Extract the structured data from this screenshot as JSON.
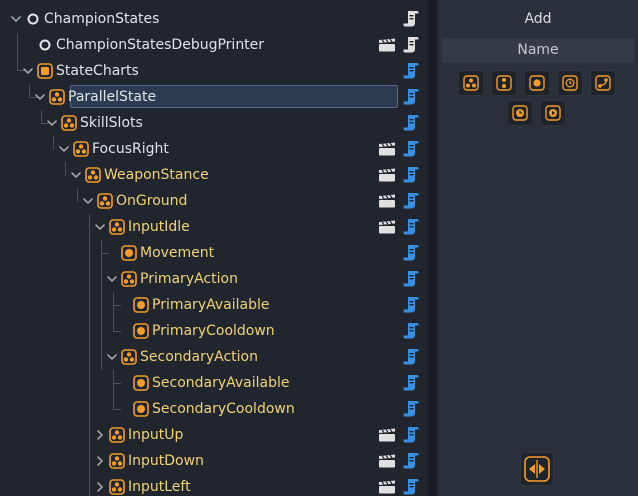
{
  "tree": {
    "rows": [
      {
        "label": "ChampionStates",
        "color": "white",
        "icon": "circle-outline-icon",
        "chevron": "down",
        "clap": false,
        "script": "gray"
      },
      {
        "label": "ChampionStatesDebugPrinter",
        "color": "white",
        "icon": "circle-outline-icon",
        "chevron": "none",
        "clap": true,
        "script": "gray"
      },
      {
        "label": "StateCharts",
        "color": "white",
        "icon": "statechart-icon",
        "chevron": "down",
        "clap": false,
        "script": "blue"
      },
      {
        "label": "ParallelState",
        "color": "white",
        "icon": "parallel-state-icon",
        "chevron": "down",
        "clap": false,
        "script": "blue",
        "selected": true
      },
      {
        "label": "SkillSlots",
        "color": "white",
        "icon": "parallel-state-icon",
        "chevron": "down",
        "clap": false,
        "script": "blue"
      },
      {
        "label": "FocusRight",
        "color": "white",
        "icon": "parallel-state-icon",
        "chevron": "down",
        "clap": true,
        "script": "blue"
      },
      {
        "label": "WeaponStance",
        "color": "gold",
        "icon": "parallel-state-icon",
        "chevron": "down",
        "clap": true,
        "script": "blue"
      },
      {
        "label": "OnGround",
        "color": "gold",
        "icon": "parallel-state-icon",
        "chevron": "down",
        "clap": true,
        "script": "blue"
      },
      {
        "label": "InputIdle",
        "color": "gold",
        "icon": "parallel-state-icon",
        "chevron": "down",
        "clap": true,
        "script": "blue"
      },
      {
        "label": "Movement",
        "color": "gold",
        "icon": "atomic-state-icon",
        "chevron": "none",
        "clap": false,
        "script": "blue"
      },
      {
        "label": "PrimaryAction",
        "color": "gold",
        "icon": "parallel-state-icon",
        "chevron": "down",
        "clap": false,
        "script": "blue"
      },
      {
        "label": "PrimaryAvailable",
        "color": "gold",
        "icon": "atomic-state-icon",
        "chevron": "none",
        "clap": false,
        "script": "blue"
      },
      {
        "label": "PrimaryCooldown",
        "color": "gold",
        "icon": "atomic-state-icon",
        "chevron": "none",
        "clap": false,
        "script": "blue"
      },
      {
        "label": "SecondaryAction",
        "color": "gold",
        "icon": "parallel-state-icon",
        "chevron": "down",
        "clap": false,
        "script": "blue"
      },
      {
        "label": "SecondaryAvailable",
        "color": "gold",
        "icon": "atomic-state-icon",
        "chevron": "none",
        "clap": false,
        "script": "blue"
      },
      {
        "label": "SecondaryCooldown",
        "color": "gold",
        "icon": "atomic-state-icon",
        "chevron": "none",
        "clap": false,
        "script": "blue"
      },
      {
        "label": "InputUp",
        "color": "gold",
        "icon": "parallel-state-icon",
        "chevron": "right",
        "clap": true,
        "script": "blue"
      },
      {
        "label": "InputDown",
        "color": "gold",
        "icon": "parallel-state-icon",
        "chevron": "right",
        "clap": true,
        "script": "blue"
      },
      {
        "label": "InputLeft",
        "color": "gold",
        "icon": "parallel-state-icon",
        "chevron": "right",
        "clap": true,
        "script": "blue"
      }
    ]
  },
  "add_panel": {
    "title": "Add",
    "column_header": "Name",
    "buttons": [
      "add-parallel-state-icon",
      "add-compound-state-icon",
      "add-atomic-state-icon",
      "add-history-state-icon",
      "add-transition-icon",
      "add-delay-icon",
      "add-event-icon"
    ],
    "toggle": "toggle-arrows-icon"
  },
  "colors": {
    "panel_bg": "#21262e",
    "selection_bg": "#2c3b52",
    "accent_orange": "#f39c2c",
    "script_blue": "#3b8fe0",
    "label_gold": "#f2d277"
  }
}
